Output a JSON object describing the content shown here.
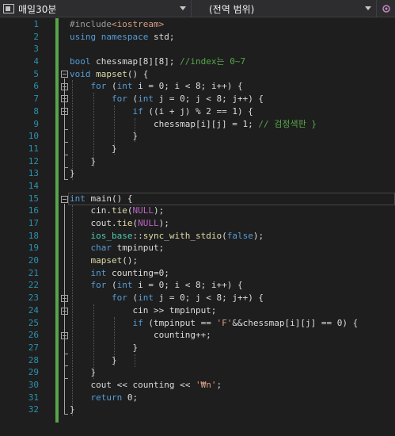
{
  "navbar": {
    "project_name": "매일30분",
    "scope_label": "(전역 범위)",
    "project_icon": "cpp-project-icon",
    "settings_icon": "settings-gear-icon"
  },
  "editor": {
    "line_numbers": [
      "1",
      "2",
      "3",
      "4",
      "5",
      "6",
      "7",
      "8",
      "9",
      "10",
      "11",
      "12",
      "13",
      "14",
      "15",
      "16",
      "17",
      "18",
      "19",
      "20",
      "21",
      "22",
      "23",
      "24",
      "25",
      "26",
      "27",
      "28",
      "29",
      "30",
      "31",
      "32"
    ],
    "code_lines": [
      "#include<iostream>",
      "using namespace std;",
      "",
      "bool chessmap[8][8]; //index는 0~7",
      "void mapset() {",
      "    for (int i = 0; i < 8; i++) {",
      "        for (int j = 0; j < 8; j++) {",
      "            if ((i + j) % 2 == 1) {",
      "                chessmap[i][j] = 1; // 검정색판 }",
      "            }",
      "        }",
      "    }",
      "}",
      "",
      "int main() {",
      "    cin.tie(NULL);",
      "    cout.tie(NULL);",
      "    ios_base::sync_with_stdio(false);",
      "    char tmpinput;",
      "    mapset();",
      "    int counting=0;",
      "    for (int i = 0; i < 8; i++) {",
      "        for (int j = 0; j < 8; j++) {",
      "            cin >> tmpinput;",
      "            if (tmpinput == 'F'&&chessmap[i][j] == 0) {",
      "                counting++;",
      "            }",
      "        }",
      "    }",
      "    cout << counting << '₩n';",
      "    return 0;",
      "}"
    ],
    "colors": {
      "background": "#1e1e1e",
      "keyword": "#569cd6",
      "comment": "#57a64a",
      "string": "#d69d85",
      "line_number": "#2b91af",
      "change_marker": "#57a64a"
    }
  }
}
